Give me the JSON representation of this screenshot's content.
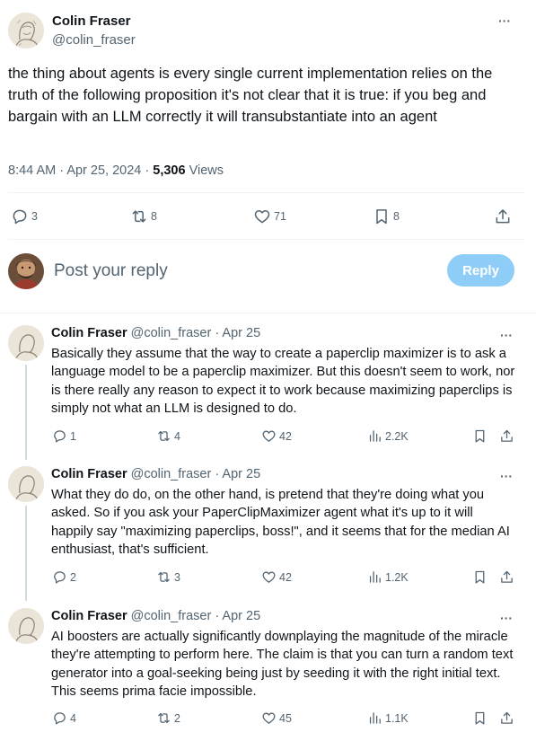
{
  "main_tweet": {
    "author_name": "Colin Fraser",
    "author_handle": "@colin_fraser",
    "text": "the thing about agents is every single current implementation relies on the truth of the following proposition it's not clear that it is true: if you beg and bargain with an LLM correctly it will transubstantiate into an agent",
    "time": "8:44 AM",
    "date": "Apr 25, 2024",
    "views_count": "5,306",
    "views_label": "Views",
    "replies": "3",
    "reposts": "8",
    "likes": "71",
    "bookmarks": "8"
  },
  "reply_box": {
    "placeholder": "Post your reply",
    "button_label": "Reply"
  },
  "replies": [
    {
      "author_name": "Colin Fraser",
      "author_handle": "@colin_fraser",
      "date": "Apr 25",
      "text": "Basically they assume that the way to create a paperclip maximizer is to ask a language model to be a paperclip maximizer. But this doesn't seem to work, nor is there really any reason to expect it to work because maximizing paperclips is simply not what an LLM is designed to do.",
      "replies": "1",
      "reposts": "4",
      "likes": "42",
      "views": "2.2K"
    },
    {
      "author_name": "Colin Fraser",
      "author_handle": "@colin_fraser",
      "date": "Apr 25",
      "text": "What they do do, on the other hand, is pretend that they're doing what you asked. So if you ask your PaperClipMaximizer agent what it's up to it will happily say \"maximizing paperclips, boss!\", and it seems that for the median AI enthusiast, that's sufficient.",
      "replies": "2",
      "reposts": "3",
      "likes": "42",
      "views": "1.2K"
    },
    {
      "author_name": "Colin Fraser",
      "author_handle": "@colin_fraser",
      "date": "Apr 25",
      "text": "AI boosters are actually significantly downplaying the magnitude of the miracle they're attempting to perform here. The claim is that you can turn a random text generator into a goal-seeking being just by seeding it with the right initial text. This seems prima facie impossible.",
      "replies": "4",
      "reposts": "2",
      "likes": "45",
      "views": "1.1K"
    }
  ],
  "separator": "·",
  "more_glyph": "···",
  "icons": {
    "reply": "reply-icon",
    "repost": "repost-icon",
    "like": "heart-icon",
    "bookmark": "bookmark-icon",
    "share": "share-icon",
    "views": "analytics-icon",
    "more": "more-icon"
  },
  "colors": {
    "text_primary": "#0f1419",
    "text_secondary": "#536471",
    "reply_button_disabled": "#8ecdf7",
    "divider": "#eff3f4",
    "thread_line": "#cfd9de"
  }
}
